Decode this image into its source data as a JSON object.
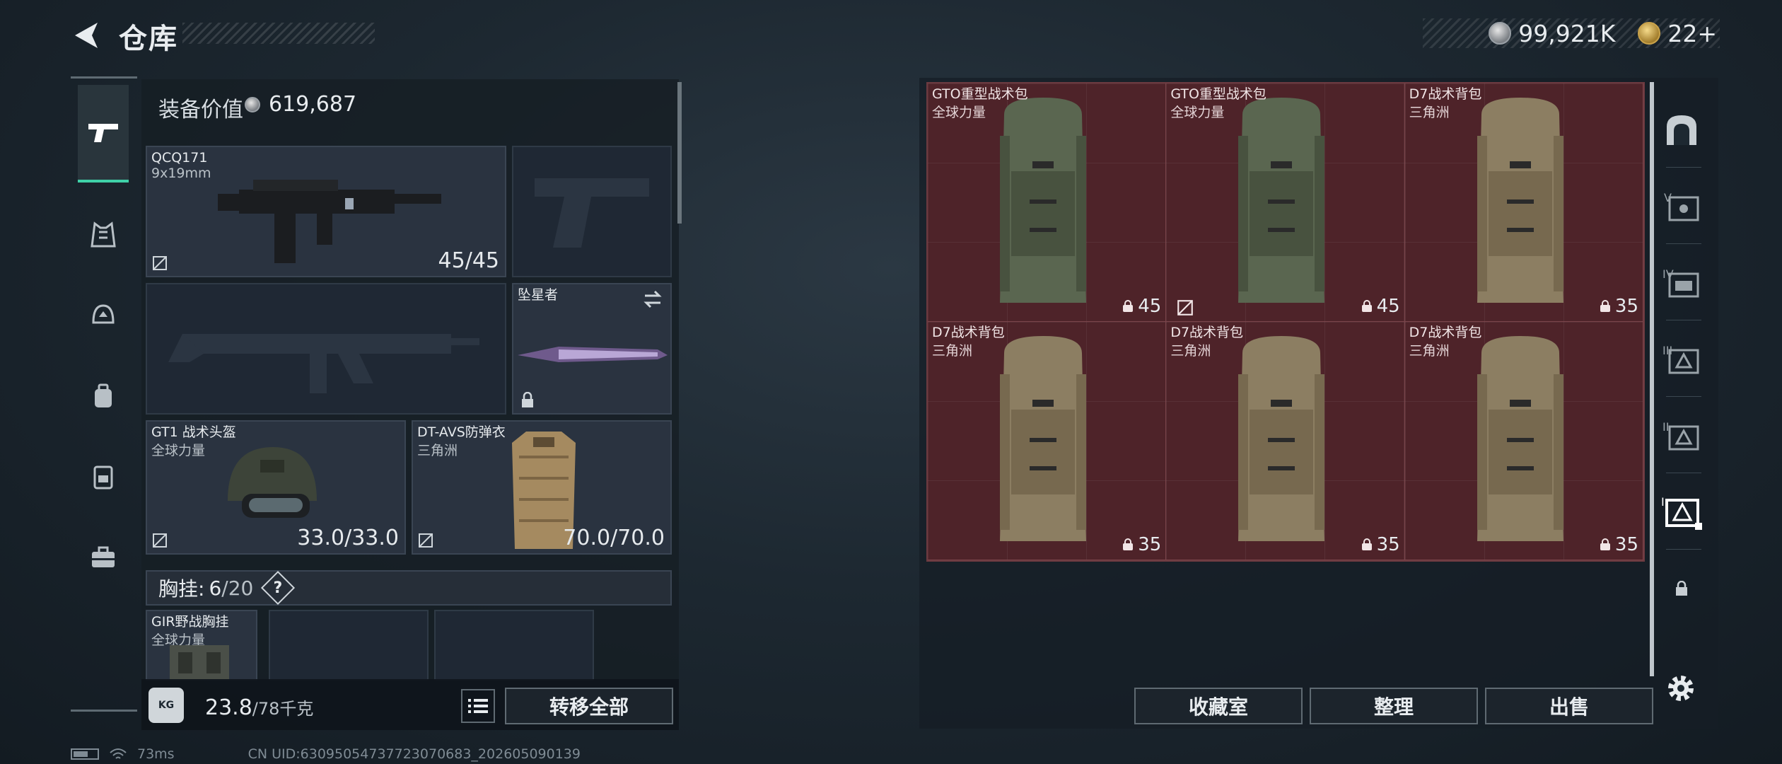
{
  "header": {
    "title": "仓库",
    "currency": [
      {
        "icon": "silver-coin-icon",
        "amount": "99,921K"
      },
      {
        "icon": "gold-coin-icon",
        "amount": "22+"
      }
    ]
  },
  "left_rail": {
    "items": [
      {
        "icon": "pistol-icon",
        "active": true
      },
      {
        "icon": "vest-icon"
      },
      {
        "icon": "helmet-icon"
      },
      {
        "icon": "backpack-icon"
      },
      {
        "icon": "chest-rig-icon"
      },
      {
        "icon": "toolbox-icon"
      }
    ]
  },
  "equipment": {
    "value_label": "装备价值",
    "value": "619,687",
    "primary_weapon": {
      "name": "QCQ171",
      "caliber": "9x19mm",
      "durability": "45/45"
    },
    "melee": {
      "name": "坠星者"
    },
    "helmet": {
      "name": "GT1 战术头盔",
      "faction": "全球力量",
      "durability": "33.0/33.0"
    },
    "armor": {
      "name": "DT-AVS防弹衣",
      "faction": "三角洲",
      "durability": "70.0/70.0"
    },
    "chest_rig": {
      "label": "胸挂:",
      "used": "6",
      "capacity": "/20",
      "help": "?"
    },
    "rig_item": {
      "name": "GIR野战胸挂",
      "faction": "全球力量"
    },
    "weight": {
      "value": "23.8",
      "capacity": "/78千克",
      "icon": "kg-icon"
    },
    "transfer_all": "转移全部"
  },
  "storage": {
    "items": [
      {
        "name": "GTO重型战术包",
        "faction": "全球力量",
        "capacity": "45",
        "color": "#5a6650",
        "nolink": false
      },
      {
        "name": "GTO重型战术包",
        "faction": "全球力量",
        "capacity": "45",
        "color": "#5a6650",
        "nolink": true
      },
      {
        "name": "D7战术背包",
        "faction": "三角洲",
        "capacity": "35",
        "color": "#8c7e62",
        "nolink": false
      },
      {
        "name": "D7战术背包",
        "faction": "三角洲",
        "capacity": "35",
        "color": "#8c7e62",
        "nolink": false
      },
      {
        "name": "D7战术背包",
        "faction": "三角洲",
        "capacity": "35",
        "color": "#8c7e62",
        "nolink": false
      },
      {
        "name": "D7战术背包",
        "faction": "三角洲",
        "capacity": "35",
        "color": "#8c7e62",
        "nolink": false
      }
    ],
    "selected_color": "#4e2329",
    "actions": {
      "collection": "收藏室",
      "organize": "整理",
      "sell": "出售"
    }
  },
  "right_rail": {
    "items": [
      {
        "icon": "safebox-icon"
      },
      {
        "icon": "storage-v-icon",
        "label": "V"
      },
      {
        "icon": "storage-iv-icon",
        "label": "IV"
      },
      {
        "icon": "storage-iii-icon",
        "label": "III"
      },
      {
        "icon": "storage-ii-icon",
        "label": "II"
      },
      {
        "icon": "storage-i-icon",
        "label": "I",
        "active": true
      },
      {
        "icon": "locked-slot-icon"
      }
    ]
  },
  "footer": {
    "ping": "73ms",
    "uid": "CN UID:6309505473772307068​3_202605090139"
  },
  "colors": {
    "accent": "#3fd1a8",
    "storage_bg": "#4e2329"
  }
}
